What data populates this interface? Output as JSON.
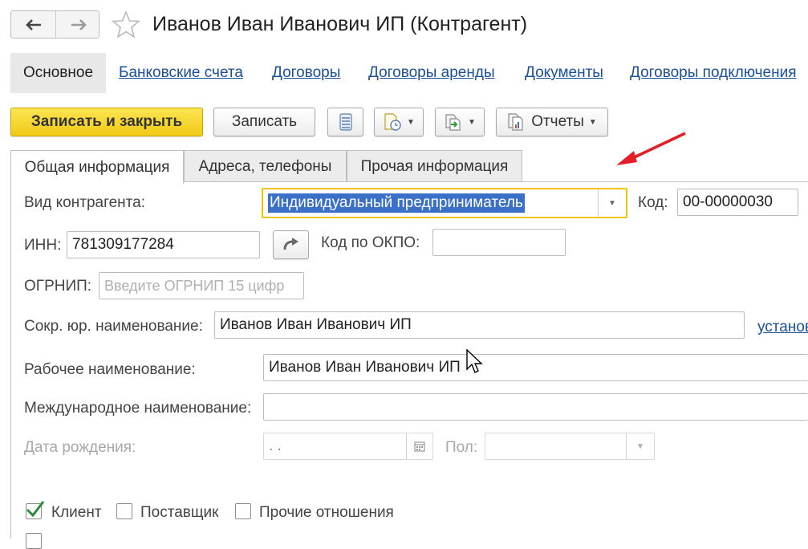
{
  "window": {
    "title": "Иванов Иван Иванович ИП (Контрагент)"
  },
  "sections": {
    "active": "Основное",
    "links": [
      "Банковские счета",
      "Договоры",
      "Договоры аренды",
      "Документы",
      "Договоры подключения"
    ]
  },
  "toolbar": {
    "save_close_label": "Записать и закрыть",
    "save_label": "Записать",
    "reports_label": "Отчеты"
  },
  "tabs": [
    "Общая информация",
    "Адреса, телефоны",
    "Прочая информация"
  ],
  "form": {
    "kind_label": "Вид контрагента:",
    "kind_value": "Индивидуальный предприниматель",
    "code_label": "Код:",
    "code_value": "00-00000030",
    "inn_label": "ИНН:",
    "inn_value": "781309177284",
    "okpo_label": "Код по ОКПО:",
    "okpo_value": "",
    "ogrnip_label": "ОГРНИП:",
    "ogrnip_placeholder": "Введите ОГРНИП 15 цифр",
    "short_name_label": "Сокр. юр. наименование:",
    "short_name_value": "Иванов Иван Иванович ИП",
    "set_link": "установ",
    "work_name_label": "Рабочее наименование:",
    "work_name_value": "Иванов Иван Иванович ИП",
    "intl_name_label": "Международное наименование:",
    "intl_name_value": "",
    "birth_label": "Дата рождения:",
    "birth_value": " .  .",
    "gender_label": "Пол:",
    "gender_value": ""
  },
  "relations": {
    "client_label": "Клиент",
    "client_checked": true,
    "supplier_label": "Поставщик",
    "supplier_checked": false,
    "other_label": "Прочие отношения",
    "other_checked": false
  },
  "colors": {
    "primary_button": "#f1c916",
    "link": "#1a4f9c",
    "selection": "#3b70c8",
    "annotation_arrow": "#e31e24"
  }
}
